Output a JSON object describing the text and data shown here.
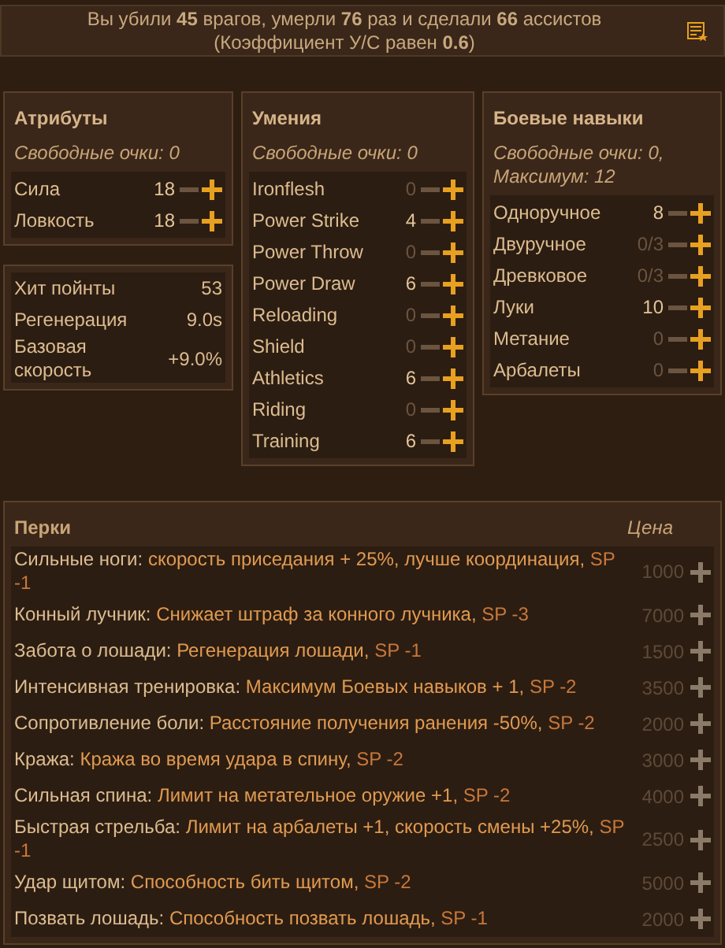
{
  "summary": {
    "lines": [
      "Вы убили **45** врагов, умерли **76** раз и сделали **66** ассистов",
      "(Коэффициент У/С равен **0.6**)"
    ]
  },
  "attributes": {
    "title": "Атрибуты",
    "free_points": "Свободные очки: 0",
    "rows": [
      {
        "label": "Сила",
        "value": "18",
        "allocated": true
      },
      {
        "label": "Ловкость",
        "value": "18",
        "allocated": true
      }
    ]
  },
  "stats": [
    {
      "label": "Хит пойнты",
      "value": "53"
    },
    {
      "label": "Регенерация",
      "value": "9.0s"
    },
    {
      "label": "Базовая скорость",
      "value": "+9.0%"
    }
  ],
  "skills": {
    "title": "Умения",
    "free_points": "Свободные очки: 0",
    "rows": [
      {
        "label": "Ironflesh",
        "value": "0",
        "allocated": false
      },
      {
        "label": "Power Strike",
        "value": "4",
        "allocated": true
      },
      {
        "label": "Power Throw",
        "value": "0",
        "allocated": false
      },
      {
        "label": "Power Draw",
        "value": "6",
        "allocated": true
      },
      {
        "label": "Reloading",
        "value": "0",
        "allocated": false
      },
      {
        "label": "Shield",
        "value": "0",
        "allocated": false
      },
      {
        "label": "Athletics",
        "value": "6",
        "allocated": true
      },
      {
        "label": "Riding",
        "value": "0",
        "allocated": false
      },
      {
        "label": "Training",
        "value": "6",
        "allocated": true
      }
    ]
  },
  "combat_skills": {
    "title": "Боевые навыки",
    "free_points": "Свободные очки: 0, Максимум: 12",
    "rows": [
      {
        "label": "Одноручное",
        "value": "8",
        "allocated": true
      },
      {
        "label": "Двуручное",
        "value": "0/3",
        "allocated": false
      },
      {
        "label": "Древковое",
        "value": "0/3",
        "allocated": false
      },
      {
        "label": "Луки",
        "value": "10",
        "allocated": true
      },
      {
        "label": "Метание",
        "value": "0",
        "allocated": false
      },
      {
        "label": "Арбалеты",
        "value": "0",
        "allocated": false
      }
    ]
  },
  "perks": {
    "title": "Перки",
    "price_heading": "Цена",
    "rows": [
      {
        "name": "Сильные ноги:",
        "description": "скорость приседания + 25%, лучше координация,",
        "sp": "SP -1",
        "price": "1000"
      },
      {
        "name": "Конный лучник:",
        "description": "Снижает штраф за конного лучника,",
        "sp": "SP -3",
        "price": "7000"
      },
      {
        "name": "Забота о лошади:",
        "description": "Регенерация лошади,",
        "sp": "SP -1",
        "price": "1500"
      },
      {
        "name": "Интенсивная тренировка:",
        "description": "Максимум Боевых навыков + 1,",
        "sp": "SP -2",
        "price": "3500"
      },
      {
        "name": "Сопротивление боли:",
        "description": "Расстояние получения ранения -50%,",
        "sp": "SP -2",
        "price": "2000"
      },
      {
        "name": "Кража:",
        "description": "Кража во время удара в спину,",
        "sp": "SP -2",
        "price": "3000"
      },
      {
        "name": "Сильная спина:",
        "description": "Лимит на метательное оружие +1,",
        "sp": "SP -2",
        "price": "4000"
      },
      {
        "name": "Быстрая стрельба:",
        "description": "Лимит на арбалеты +1, скорость смены +25%,",
        "sp": "SP -1",
        "price": "2500"
      },
      {
        "name": "Удар щитом:",
        "description": "Способность бить щитом,",
        "sp": "SP -2",
        "price": "5000"
      },
      {
        "name": "Позвать лошадь:",
        "description": "Способность позвать лошадь,",
        "sp": "SP -1",
        "price": "2000"
      }
    ]
  }
}
